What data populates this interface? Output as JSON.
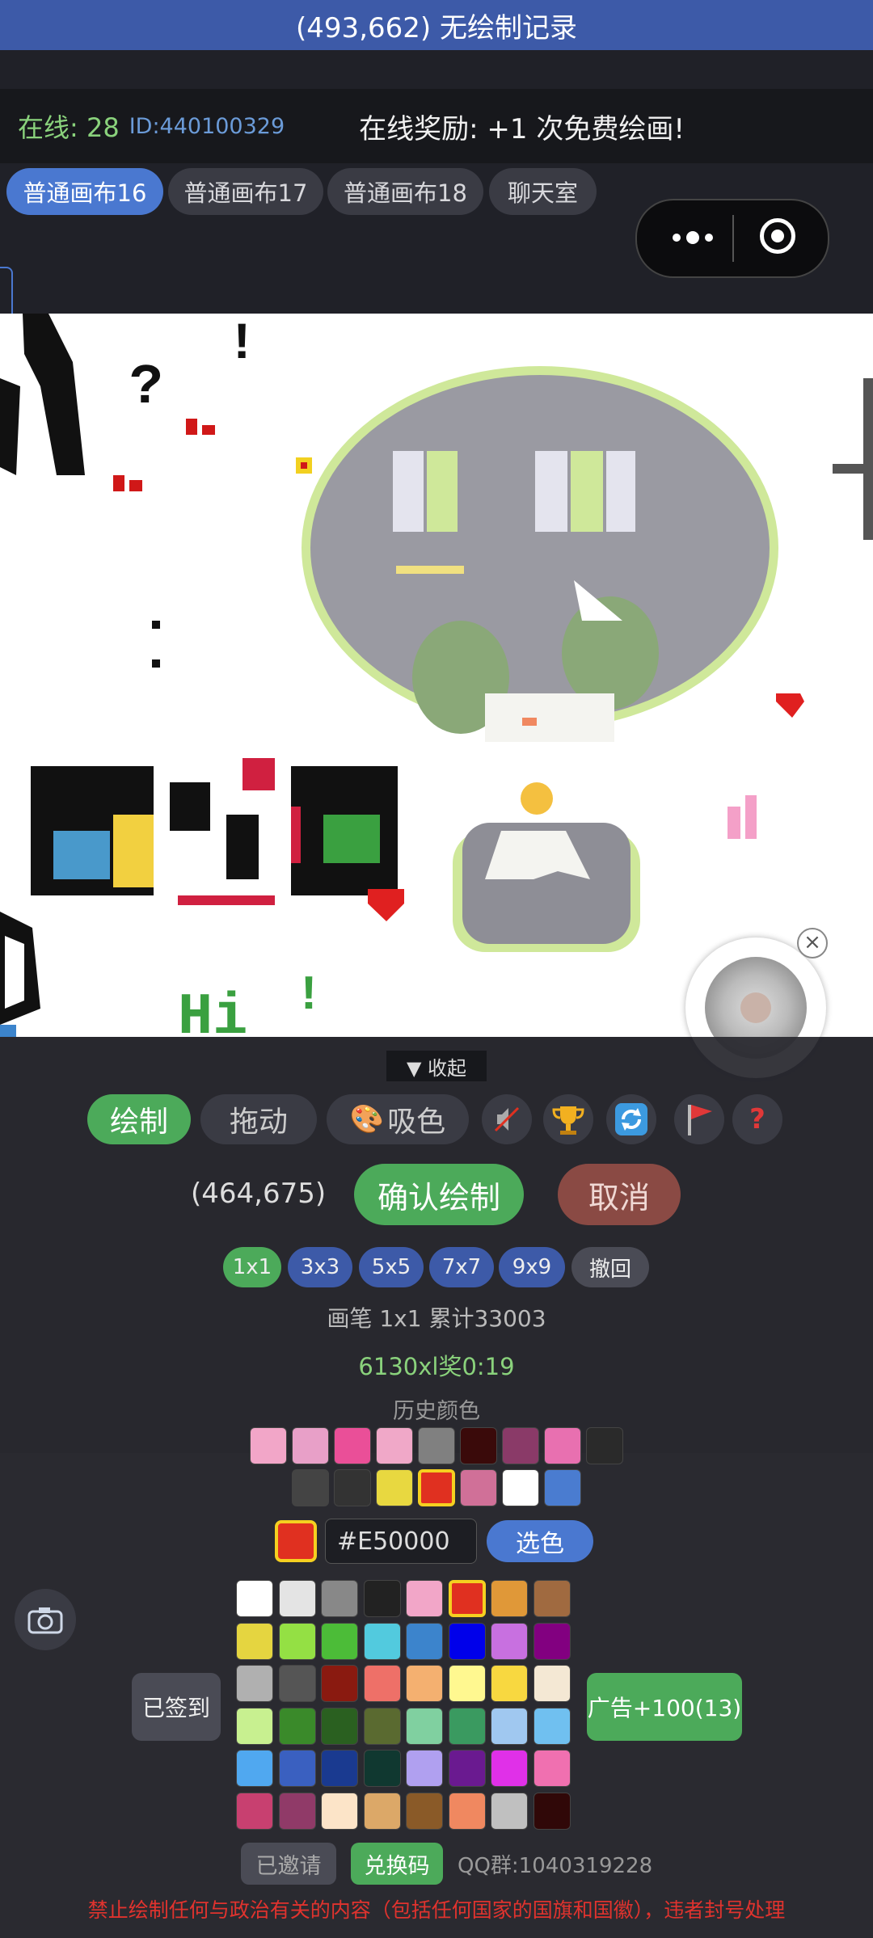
{
  "header": {
    "title": "(493,662) 无绘制记录"
  },
  "info": {
    "online": "在线: 28",
    "user_id": "ID:440100329",
    "reward": "在线奖励: +1 次免费绘画!"
  },
  "tabs": [
    {
      "label": "普通画布16",
      "active": true
    },
    {
      "label": "普通画布17",
      "active": false
    },
    {
      "label": "普通画布18",
      "active": false
    },
    {
      "label": "聊天室",
      "active": false
    }
  ],
  "canvas": {
    "texts": [
      "?",
      "!",
      "!",
      "Hi",
      "Hi"
    ]
  },
  "panel": {
    "collapse_label": "▼ 收起",
    "modes": {
      "draw": "绘制",
      "drag": "拖动",
      "pick": "吸色"
    },
    "icons": [
      "mute-icon",
      "trophy-icon",
      "refresh-icon",
      "flag-icon",
      "help-icon"
    ],
    "help_glyph": "?",
    "coords": "(464,675)",
    "confirm": "确认绘制",
    "cancel": "取消",
    "sizes": [
      "1x1",
      "3x3",
      "5x5",
      "7x7",
      "9x9"
    ],
    "undo": "撤回",
    "brush_info": "画笔 1x1  累计33003",
    "timer": "6130xl奖0:19",
    "history_label": "历史颜色"
  },
  "history_colors": [
    [
      "#f2a6c8",
      "#e8a0c8",
      "#ea4f98",
      "#f0a8c8",
      "#808080",
      "#3a0a0a",
      "#8a3a68",
      "#e870b0",
      "#2a2a2a"
    ],
    [
      "#444444",
      "#333333",
      "#e8d840",
      "#e03020",
      "#d07098",
      "#ffffff",
      "#4a7cd0"
    ]
  ],
  "history_selected_index": [
    1,
    3
  ],
  "current_color": {
    "hex": "#E50000",
    "swatch": "#e03020",
    "pick_label": "选色"
  },
  "palette": [
    [
      "#ffffff",
      "#e4e4e4",
      "#888888",
      "#222222",
      "#f2a6c8",
      "#e03020",
      "#e09838",
      "#a06a40"
    ],
    [
      "#e5d540",
      "#94e044",
      "#4cbc38",
      "#52cade",
      "#3c84cc",
      "#0000ea",
      "#c870e0",
      "#820080"
    ],
    [
      "#b0b0b0",
      "#555555",
      "#8a1a10",
      "#ee7068",
      "#f4b070",
      "#fff890",
      "#f8d840",
      "#f4e8d4"
    ],
    [
      "#c8f090",
      "#3a8a2a",
      "#2a6020",
      "#5a6a30",
      "#80d0a0",
      "#3a9a60",
      "#a0c8f0",
      "#70c0f0"
    ],
    [
      "#50a8f0",
      "#3a60c0",
      "#1a3a90",
      "#103830",
      "#b0a0f0",
      "#6a1a90",
      "#e030e8",
      "#f070b0"
    ],
    [
      "#c84070",
      "#903a68",
      "#fce4c8",
      "#dca868",
      "#8a5a28",
      "#f08860",
      "#c0c0c0",
      "#300808"
    ]
  ],
  "palette_selected": [
    0,
    5
  ],
  "buttons": {
    "signed": "已签到",
    "ad": "广告+100(13)",
    "invited": "已邀请",
    "redeem": "兑换码",
    "qq": "QQ群:1040319228"
  },
  "warning": "禁止绘制任何与政治有关的内容（包括任何国家的国旗和国徽），违者封号处理"
}
